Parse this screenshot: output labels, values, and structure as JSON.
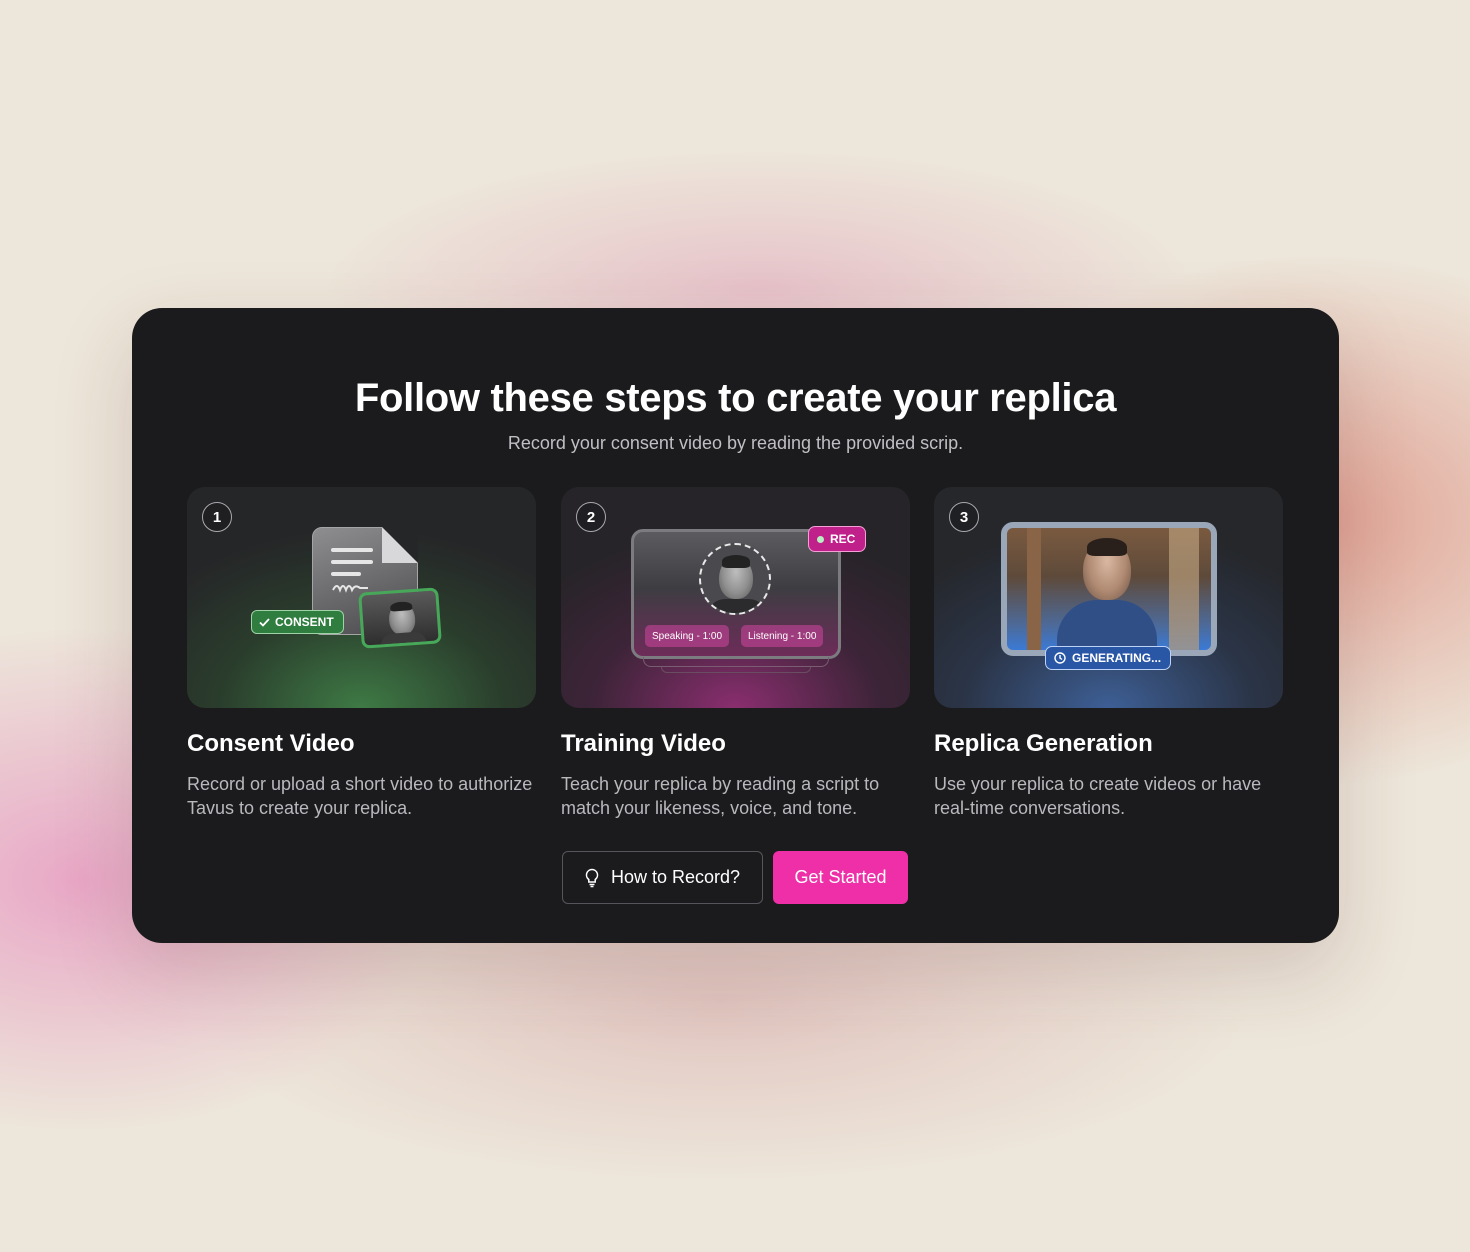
{
  "header": {
    "title": "Follow these steps to create your replica",
    "subtitle": "Record your consent video by reading the provided scrip."
  },
  "steps": [
    {
      "number": "1",
      "title": "Consent Video",
      "description": "Record or upload a short video to authorize Tavus to create your replica.",
      "badge": "CONSENT",
      "accent": "#2f7d3f"
    },
    {
      "number": "2",
      "title": "Training Video",
      "description": "Teach your replica by reading a script to match your likeness, voice, and tone.",
      "badge": "REC",
      "pills": [
        "Speaking - 1:00",
        "Listening - 1:00"
      ],
      "accent": "#c0208a"
    },
    {
      "number": "3",
      "title": "Replica Generation",
      "description": "Use your replica to create videos or have real-time conversations.",
      "badge": "GENERATING...",
      "accent": "#2a56a6"
    }
  ],
  "actions": {
    "how_to_label": "How to Record?",
    "how_to_icon": "lightbulb-icon",
    "get_started_label": "Get Started",
    "primary_color": "#ee2fa8"
  }
}
